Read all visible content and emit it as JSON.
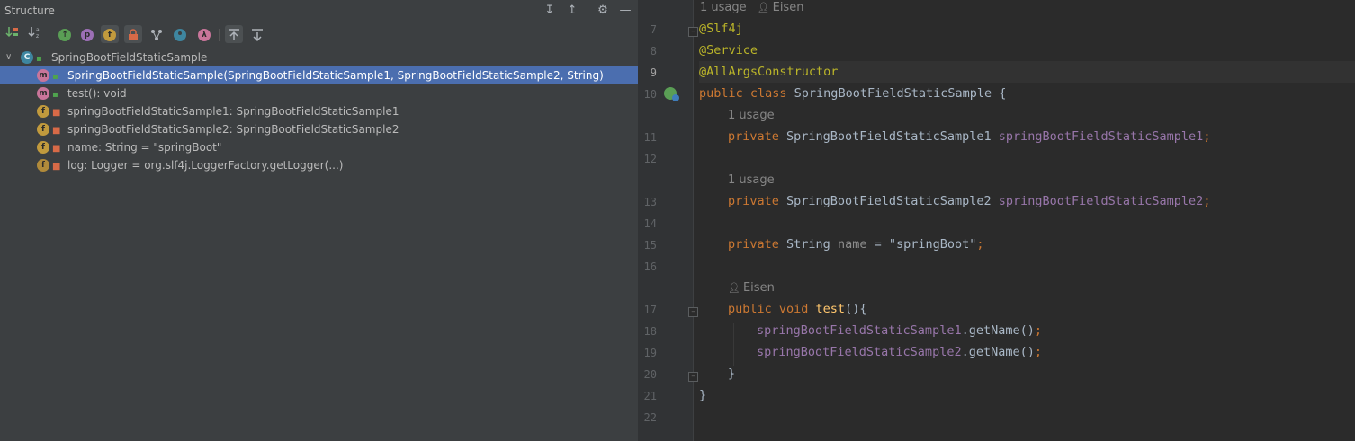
{
  "structure": {
    "title": "Structure",
    "toolbar": [
      "sort-visibility-icon",
      "sort-alpha-icon",
      "show-inherited-icon",
      "show-properties-icon",
      "show-fields-icon",
      "show-non-public-icon",
      "show-anonymous-icon",
      "show-lambdas-icon",
      "autoscroll-to-source-icon",
      "autoscroll-from-source-icon"
    ],
    "tree": {
      "class_name": "SpringBootFieldStaticSample",
      "members": [
        {
          "kind": "m",
          "visibility": "public",
          "label": "SpringBootFieldStaticSample(SpringBootFieldStaticSample1, SpringBootFieldStaticSample2, String)",
          "selected": true
        },
        {
          "kind": "m",
          "visibility": "public",
          "label": "test(): void"
        },
        {
          "kind": "f",
          "visibility": "private",
          "label": "springBootFieldStaticSample1: SpringBootFieldStaticSample1"
        },
        {
          "kind": "f",
          "visibility": "private",
          "label": "springBootFieldStaticSample2: SpringBootFieldStaticSample2"
        },
        {
          "kind": "f",
          "visibility": "private",
          "label": "name: String = \"springBoot\""
        },
        {
          "kind": "f",
          "visibility": "private",
          "label": "log: Logger = org.slf4j.LoggerFactory.getLogger(...)"
        }
      ]
    }
  },
  "editor": {
    "hints": {
      "usage_class": "1 usage",
      "author": "Eisen",
      "usage_field1": "1 usage",
      "usage_field2": "1 usage"
    },
    "line_numbers": [
      "7",
      "8",
      "9",
      "10",
      "11",
      "12",
      "13",
      "14",
      "15",
      "16",
      "17",
      "18",
      "19",
      "20",
      "21",
      "22"
    ],
    "code": {
      "l7": "@Slf4j",
      "l8": "@Service",
      "l9": "@AllArgsConstructor",
      "l10_kw": "public class ",
      "l10_name": "SpringBootFieldStaticSample {",
      "l11_kw": "private ",
      "l11_type": "SpringBootFieldStaticSample1 ",
      "l11_field": "springBootFieldStaticSample1",
      "l11_end": ";",
      "l13_kw": "private ",
      "l13_type": "SpringBootFieldStaticSample2 ",
      "l13_field": "springBootFieldStaticSample2",
      "l13_end": ";",
      "l15_kw": "private ",
      "l15_type": "String ",
      "l15_field": "name",
      "l15_eq": " = ",
      "l15_str": "\"springBoot\"",
      "l15_end": ";",
      "l17_kw": "public void ",
      "l17_meth": "test",
      "l17_rest": "(){",
      "l18_field": "springBootFieldStaticSample1",
      "l18_call": ".getName()",
      "l18_end": ";",
      "l19_field": "springBootFieldStaticSample2",
      "l19_call": ".getName()",
      "l19_end": ";",
      "l20": "}",
      "l21": "}"
    }
  }
}
